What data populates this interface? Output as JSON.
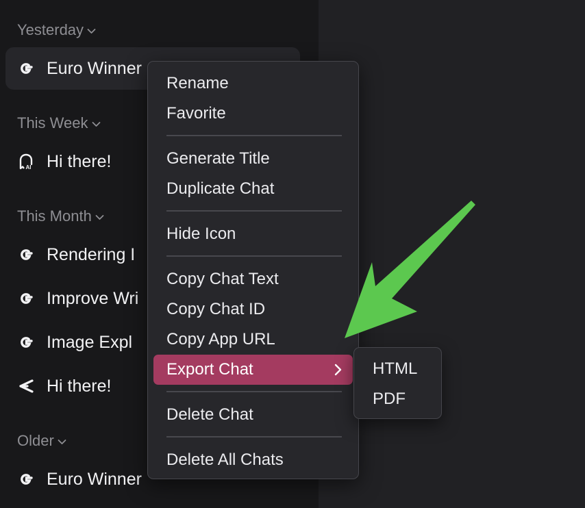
{
  "sidebar": {
    "sections": [
      {
        "title": "Yesterday",
        "items": [
          {
            "label": "Euro Winner",
            "icon": "google-icon",
            "selected": true
          }
        ]
      },
      {
        "title": "This Week",
        "items": [
          {
            "label": "Hi there!",
            "icon": "ai-ghost-icon"
          }
        ]
      },
      {
        "title": "This Month",
        "items": [
          {
            "label": "Rendering I",
            "icon": "google-icon"
          },
          {
            "label": "Improve Wri",
            "icon": "google-icon"
          },
          {
            "label": "Image Expl",
            "icon": "google-icon"
          },
          {
            "label": "Hi there!",
            "icon": "share-arrow-icon"
          }
        ]
      },
      {
        "title": "Older",
        "items": [
          {
            "label": "Euro Winner",
            "icon": "google-icon"
          }
        ]
      }
    ]
  },
  "context_menu": {
    "items": [
      "Rename",
      "Favorite",
      "Generate Title",
      "Duplicate Chat",
      "Hide Icon",
      "Copy Chat Text",
      "Copy Chat ID",
      "Copy App URL",
      "Export Chat",
      "Delete Chat",
      "Delete All Chats"
    ],
    "active_item": "Export Chat"
  },
  "export_submenu": {
    "items": [
      "HTML",
      "PDF"
    ]
  },
  "colors": {
    "sidebar_bg": "#18181a",
    "main_bg": "#212124",
    "menu_bg": "#27272b",
    "highlight": "#a43b60",
    "annotation_arrow": "#5cc84f"
  }
}
